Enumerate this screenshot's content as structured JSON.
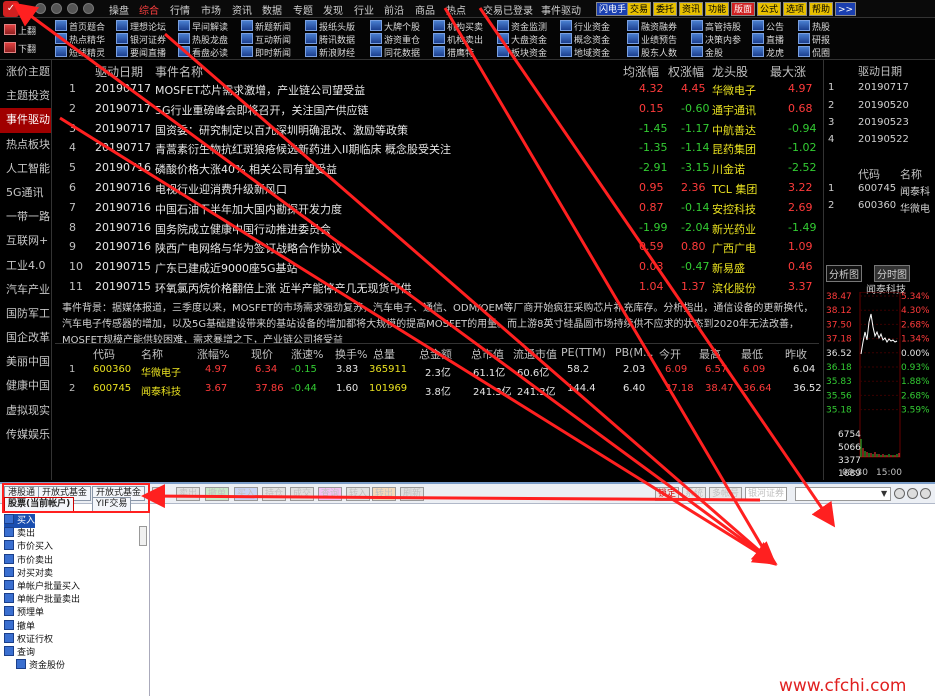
{
  "menubar": {
    "items": [
      "操盘",
      "综合",
      "行情",
      "市场",
      "资讯",
      "数据",
      "专题",
      "发现",
      "行业",
      "前沿",
      "商品",
      "热点"
    ],
    "login": "交易已登录",
    "event_drive": "事件驱动",
    "tags": [
      "闪电手",
      "交易",
      "委托",
      "资讯",
      "功能",
      "版面",
      "公式",
      "选项",
      "帮助",
      ">>"
    ]
  },
  "toolbar": {
    "left": [
      "上翻",
      "下翻"
    ],
    "col1": [
      "首页题合",
      "热点精华",
      "短线精灵"
    ],
    "col2": [
      "理想论坛",
      "银河证券",
      "要闻直播"
    ],
    "col3": [
      "早间解读",
      "热股龙盘",
      "看盘必读"
    ],
    "col4": [
      "新题新闻",
      "互动新闻",
      "即时新闻"
    ],
    "col5": [
      "报纸头版",
      "腾讯数据",
      "新浪财经"
    ],
    "col6": [
      "大牌个股",
      "游资重仓",
      "同花数据"
    ],
    "col7": [
      "机构买卖",
      "机构卖出",
      "猎鹰特"
    ],
    "col8": [
      "资金监测",
      "大盘资金",
      "板块资金"
    ],
    "col9": [
      "行业资金",
      "概念资金",
      "地域资金"
    ],
    "col10": [
      "融资融券",
      "业绩预告",
      "股东人数"
    ],
    "col11": [
      "高管持股",
      "决策内参",
      "金股"
    ],
    "col12": [
      "公告",
      "直播",
      "龙虎"
    ],
    "col13": [
      "热股",
      "研报",
      "侃圈"
    ]
  },
  "sidebar": {
    "items": [
      "涨价主题",
      "主题投资",
      "事件驱动",
      "热点板块",
      "人工智能",
      "5G通讯",
      "一带一路",
      "互联网+",
      "工业4.0",
      "汽车产业",
      "国防军工",
      "国企改革",
      "美丽中国",
      "健康中国",
      "虚拟现实",
      "传媒娱乐"
    ],
    "selected": 2
  },
  "events": {
    "headers": [
      "驱动日期",
      "事件名称",
      "均涨幅",
      "权涨幅",
      "龙头股",
      "最大涨"
    ],
    "rows": [
      {
        "idx": "1",
        "date": "20190717",
        "name": "MOSFET芯片需求激增，产业链公司望受益",
        "avg": "4.32",
        "wt": "4.45",
        "leader": "华微电子",
        "max": "4.97",
        "dir": "up"
      },
      {
        "idx": "2",
        "date": "20190717",
        "name": "5G行业重磅峰会即将召开，关注国产供应链",
        "avg": "0.15",
        "wt": "-0.60",
        "leader": "通宇通讯",
        "max": "0.68",
        "dir": "mix"
      },
      {
        "idx": "3",
        "date": "20190717",
        "name": "国资委：研究制定以百九深圳明确混改、激励等政策",
        "avg": "-1.45",
        "wt": "-1.17",
        "leader": "中航善达",
        "max": "-0.94",
        "dir": "down"
      },
      {
        "idx": "4",
        "date": "20190717",
        "name": "青蒿素衍生物抗红斑狼疮候选新药进入II期临床 概念股受关注",
        "avg": "-1.35",
        "wt": "-1.14",
        "leader": "昆药集团",
        "max": "-1.02",
        "dir": "down"
      },
      {
        "idx": "5",
        "date": "20190716",
        "name": "磷酸价格大涨40% 相关公司有望受益",
        "avg": "-2.91",
        "wt": "-3.15",
        "leader": "川金诺",
        "max": "-2.52",
        "dir": "down"
      },
      {
        "idx": "6",
        "date": "20190716",
        "name": "电视行业迎消费升级新风口",
        "avg": "0.95",
        "wt": "2.36",
        "leader": "TCL 集团",
        "max": "3.22",
        "dir": "up"
      },
      {
        "idx": "7",
        "date": "20190716",
        "name": "中国石油下半年加大国内勘探开发力度",
        "avg": "0.87",
        "wt": "-0.14",
        "leader": "安控科技",
        "max": "2.69",
        "dir": "mix"
      },
      {
        "idx": "8",
        "date": "20190716",
        "name": "国务院成立健康中国行动推进委员会",
        "avg": "-1.99",
        "wt": "-2.04",
        "leader": "新光药业",
        "max": "-1.49",
        "dir": "down"
      },
      {
        "idx": "9",
        "date": "20190716",
        "name": "陕西广电网络与华为签订战略合作协议",
        "avg": "0.59",
        "wt": "0.80",
        "leader": "广西广电",
        "max": "1.09",
        "dir": "up"
      },
      {
        "idx": "10",
        "date": "20190715",
        "name": "广东已建成近9000座5G基站",
        "avg": "0.03",
        "wt": "-0.47",
        "leader": "新易盛",
        "max": "0.46",
        "dir": "mix"
      },
      {
        "idx": "11",
        "date": "20190715",
        "name": "环氧氯丙烷价格翻倍上涨 近半产能停产几无现货可供",
        "avg": "1.04",
        "wt": "1.37",
        "leader": "滨化股份",
        "max": "3.37",
        "dir": "up"
      }
    ]
  },
  "background": {
    "line1": "事件背景：据媒体报道，三季度以来，MOSFET的市场需求强劲复苏，汽车电子、通信、ODM/OEM等厂商开始疯狂采购芯片补充库存。分析指出，通信设备的更新换代，",
    "line2": "汽车电子传感器的增加，以及5G基础建设带来的基站设备的增加都将大规模的提高MOSFET的用量。而上游8英寸硅晶圆市场持续供不应求的状态到2020年无法改善，",
    "line3": "MOSFET规模产能供较困难，需求暴增之下，产业链公司将受益"
  },
  "stocks": {
    "headers": [
      "代码",
      "名称",
      "涨幅%",
      "现价",
      "涨速%",
      "换手%",
      "总量",
      "总金额",
      "总市值",
      "流通市值",
      "PE(TTM)",
      "PB(M...",
      "今开",
      "最高",
      "最低",
      "昨收"
    ],
    "rows": [
      {
        "idx": "1",
        "code": "600360",
        "name": "华微电子",
        "chg": "4.97",
        "price": "6.34",
        "speed": "-0.15",
        "turnover": "3.83",
        "vol": "365911",
        "amount": "2.3亿",
        "mktcap": "61.1亿",
        "float": "60.6亿",
        "pe": "58.2",
        "pb": "2.03",
        "open": "6.09",
        "high": "6.57",
        "low": "6.09",
        "prev": "6.04"
      },
      {
        "idx": "2",
        "code": "600745",
        "name": "闻泰科技",
        "chg": "3.67",
        "price": "37.86",
        "speed": "-0.44",
        "turnover": "1.60",
        "vol": "101969",
        "amount": "3.8亿",
        "mktcap": "241.3亿",
        "float": "241.3亿",
        "pe": "144.4",
        "pb": "6.40",
        "open": "37.18",
        "high": "38.47",
        "low": "36.64",
        "prev": "36.52"
      }
    ]
  },
  "right_panel": {
    "header1": [
      "驱动日期"
    ],
    "dates": [
      "20190717",
      "20190520",
      "20190523",
      "20190522"
    ],
    "header2": [
      "代码",
      "名称"
    ],
    "codes": [
      {
        "idx": "1",
        "code": "600745",
        "name": "闻泰科"
      },
      {
        "idx": "2",
        "code": "600360",
        "name": "华微电"
      }
    ],
    "tabs": [
      "分析图",
      "分时图"
    ],
    "chart_title": "闻泰科技",
    "prices": [
      "38.47",
      "38.12",
      "37.50",
      "37.18",
      "36.52",
      "36.18",
      "35.83",
      "35.56",
      "35.18"
    ],
    "pcts": [
      "5.34%",
      "4.30%",
      "2.68%",
      "1.34%",
      "0.00%",
      "0.93%",
      "1.88%",
      "2.68%",
      "3.59%"
    ],
    "vols": [
      "6754",
      "5066",
      "3377",
      "1689"
    ],
    "times": [
      "09:30",
      "15:00"
    ]
  },
  "trade": {
    "tabs": [
      "港股通",
      "开放式基金",
      "开放式基金"
    ],
    "subtabs": [
      "股票(当前帐户)",
      "YIF交易"
    ],
    "buttons": [
      "«",
      "卖出",
      "撤单",
      "买入",
      "持仓",
      "成交",
      "查询",
      "转入",
      "转出",
      "刷新"
    ],
    "right_labels": [
      "锁定",
      "系统",
      "多帐号",
      "银河证券"
    ],
    "tree": [
      "买入",
      "卖出",
      "市价买入",
      "市价卖出",
      "对买对卖",
      "单帐户批量买入",
      "单帐户批量卖出",
      "预埋单",
      "撤单",
      "权证行权",
      "查询",
      "资金股份"
    ]
  },
  "watermark": "www.cfchi.com",
  "colors": {
    "up": "#ff3b3b",
    "down": "#33cc33",
    "leader": "#e8e020",
    "selected": "#a00000",
    "arrow": "#ff2020"
  }
}
